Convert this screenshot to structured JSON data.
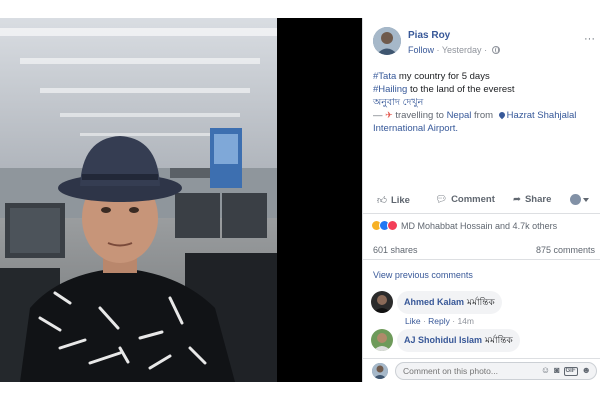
{
  "post": {
    "author": "Pias Roy",
    "follow_label": "Follow",
    "separator": " · ",
    "time": "Yesterday",
    "separator2": " · ",
    "more_label": "···",
    "text": {
      "line1_tag": "#Tata",
      "line1_rest": " my country for 5 days",
      "line2_tag": "#Hailing",
      "line2_rest": " to the land of the everest",
      "translate": "অনুবাদ দেখুন",
      "travel_prefix": "— ",
      "travel_mid": " travelling to ",
      "destination": "Nepal",
      "from_label": " from ",
      "origin": "Hazrat Shahjalal International Airport",
      "end": "."
    }
  },
  "actions": {
    "like": "Like",
    "comment": "Comment",
    "share": "Share"
  },
  "reactions": {
    "summary": "MD Mohabbat Hossain and 4.7k others"
  },
  "counts": {
    "shares": "601 shares",
    "comments": "875 comments"
  },
  "comments": {
    "view_previous": "View previous comments",
    "items": [
      {
        "name": "Ahmed Kalam",
        "text": "মর্মান্তিক",
        "like": "Like",
        "dot": " · ",
        "reply": "Reply",
        "dot2": " · ",
        "time": "14m"
      },
      {
        "name": "AJ Shohidul Islam",
        "text": "মর্মান্তিক"
      }
    ],
    "input_placeholder": "Comment on this photo..."
  },
  "icons": {
    "like": "thumbs-up-icon",
    "comment": "speech-bubble-icon",
    "share": "share-arrow-icon",
    "globe": "globe-icon",
    "plane": "airplane-icon",
    "pin": "location-pin-icon",
    "emoji": "emoji-icon",
    "camera": "camera-icon",
    "gif": "gif-icon",
    "sticker": "sticker-icon"
  },
  "colors": {
    "link": "#385898",
    "muted": "#90949c",
    "like_reaction": "#2078f4",
    "love_reaction": "#f33e58",
    "sad_reaction": "#f7b125"
  }
}
